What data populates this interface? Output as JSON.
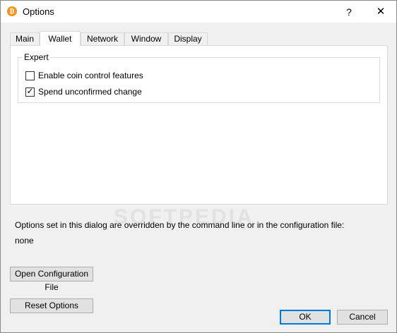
{
  "window": {
    "title": "Options",
    "help_label": "?",
    "close_label": "✕"
  },
  "tabs": [
    {
      "label": "Main"
    },
    {
      "label": "Wallet"
    },
    {
      "label": "Network"
    },
    {
      "label": "Window"
    },
    {
      "label": "Display"
    }
  ],
  "active_tab": "Wallet",
  "expert_group": {
    "title": "Expert",
    "options": [
      {
        "label": "Enable coin control features",
        "checked": false
      },
      {
        "label": "Spend unconfirmed change",
        "checked": true
      }
    ]
  },
  "config_note": {
    "text": "Options set in this dialog are overridden by the command line or in the configuration file:",
    "value": "none"
  },
  "buttons": {
    "open_config": "Open Configuration File",
    "reset": "Reset Options",
    "ok": "OK",
    "cancel": "Cancel"
  },
  "watermark": "SOFTPEDIA",
  "colors": {
    "accent": "#0078d7",
    "app_icon": "#f7931a"
  }
}
